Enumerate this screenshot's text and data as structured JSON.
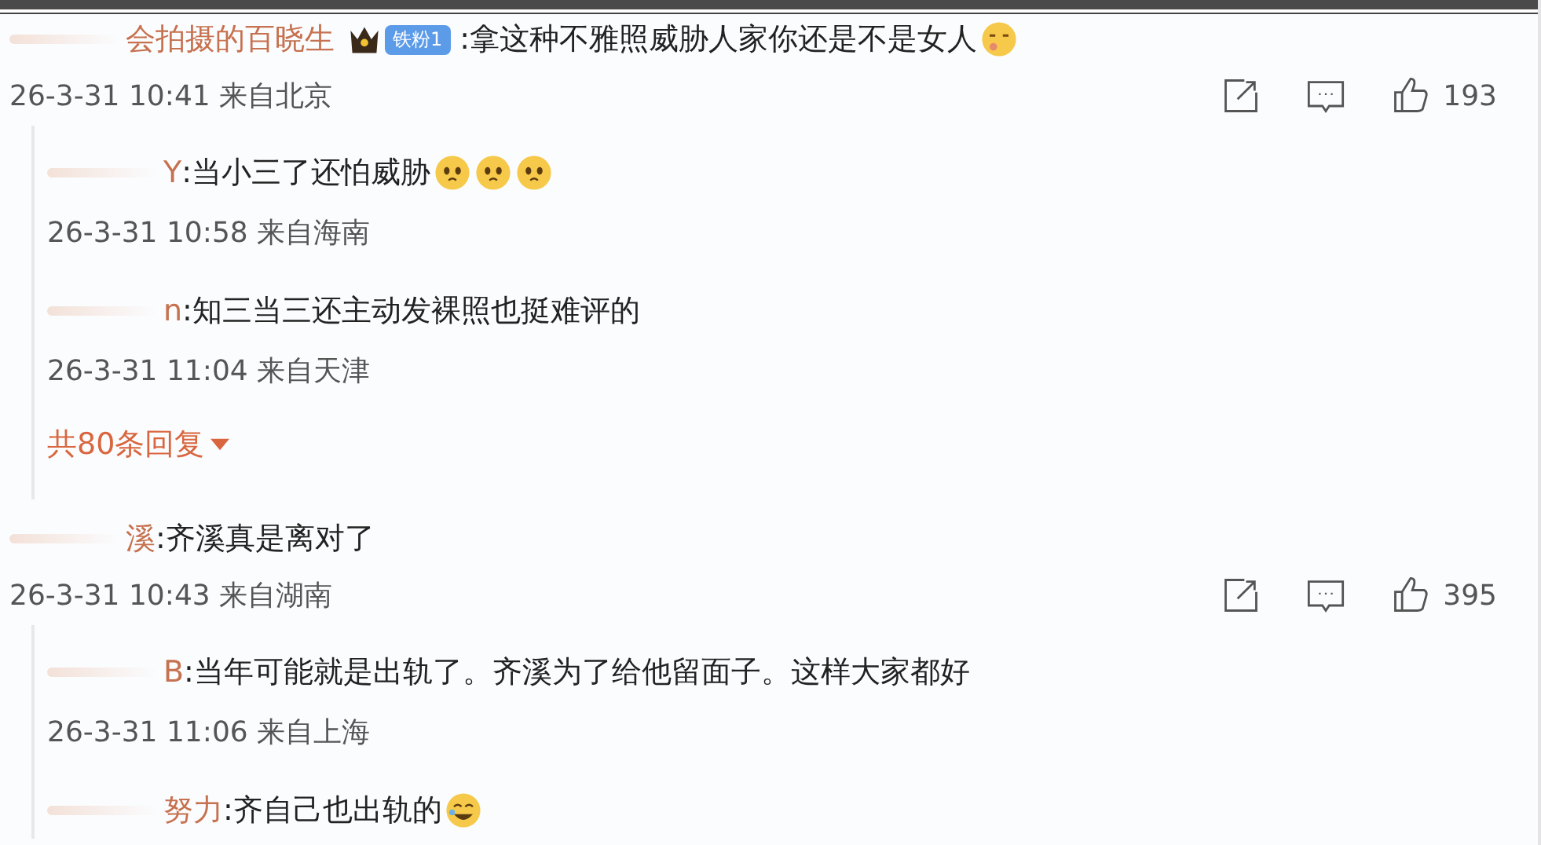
{
  "comments": [
    {
      "author": "会拍摄的百晓生",
      "crown": true,
      "badge": "铁粉1",
      "redacted": true,
      "text": ":拿这种不雅照威胁人家你还是不是女人",
      "emojis": [
        {
          "kind": "smirk"
        }
      ],
      "meta": "26-3-31 10:41 来自北京",
      "likes": "193",
      "replies": [
        {
          "author": "Y",
          "redacted": true,
          "text": ":当小三了还怕威胁",
          "emojis": [
            {
              "kind": "pleading"
            },
            {
              "kind": "pleading"
            },
            {
              "kind": "pleading"
            }
          ],
          "meta": "26-3-31 10:58 来自海南"
        },
        {
          "author": "n",
          "redacted": true,
          "text": ":知三当三还主动发裸照也挺难评的",
          "meta": "26-3-31 11:04 来自天津"
        }
      ],
      "more": "共80条回复"
    },
    {
      "author": "溪",
      "redacted": true,
      "text": ":齐溪真是离对了",
      "meta": "26-3-31 10:43 来自湖南",
      "likes": "395",
      "replies": [
        {
          "author": "B",
          "redacted": true,
          "text": ":当年可能就是出轨了。齐溪为了给他留面子。这样大家都好",
          "meta": "26-3-31 11:06 来自上海"
        },
        {
          "author": "努力",
          "redacted": true,
          "text": ":齐自己也出轨的",
          "emojis": [
            {
              "kind": "laughing"
            }
          ]
        }
      ]
    }
  ]
}
